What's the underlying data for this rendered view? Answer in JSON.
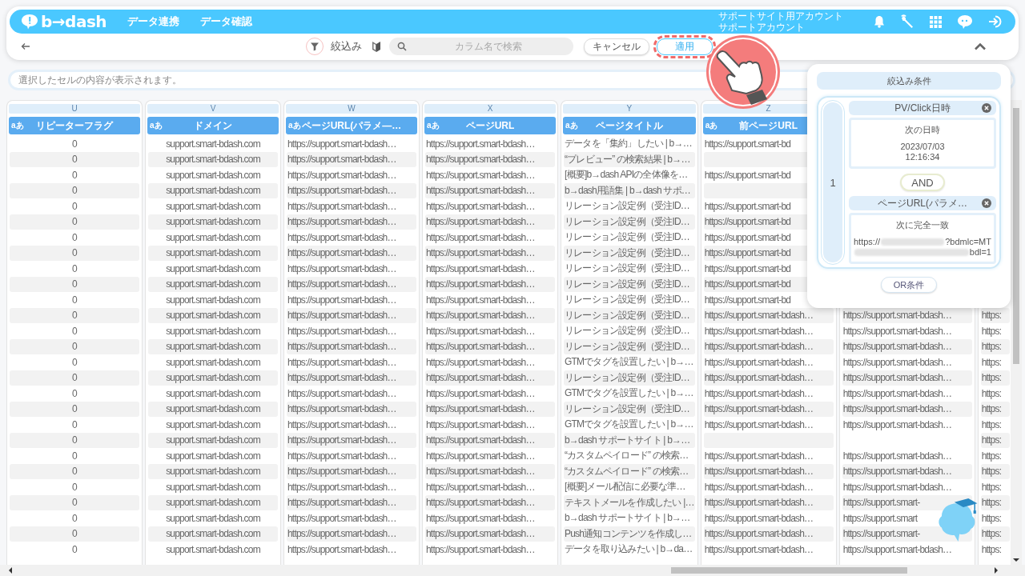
{
  "header": {
    "logo": "b→dash",
    "nav": [
      {
        "label": "データ連携"
      },
      {
        "label": "データ確認"
      }
    ],
    "account": {
      "site": "サポートサイト用アカウント",
      "name": "サポートアカウント"
    }
  },
  "toolbar": {
    "filter_label": "絞込み",
    "search": {
      "placeholder": "カラム名で検索"
    },
    "buttons": [
      {
        "label": "キャンセル",
        "kind": "secondary",
        "highlighted": false
      },
      {
        "label": "適用",
        "kind": "primary",
        "highlighted": true
      }
    ]
  },
  "cell_viewer": {
    "placeholder": "選択したセルの内容が表示されます。"
  },
  "table": {
    "columns": [
      {
        "letter": "U",
        "type_label": "aあ",
        "label": "リピーターフラグ",
        "cells": [
          "0",
          "0",
          "0",
          "0",
          "0",
          "0",
          "0",
          "0",
          "0",
          "0",
          "0",
          "0",
          "0",
          "0",
          "0",
          "0",
          "0",
          "0",
          "0",
          "0",
          "0",
          "0",
          "0",
          "0",
          "0",
          "0",
          "0"
        ]
      },
      {
        "letter": "V",
        "type_label": "aあ",
        "label": "ドメイン",
        "cells": [
          "support.smart-bdash.com",
          "support.smart-bdash.com",
          "support.smart-bdash.com",
          "support.smart-bdash.com",
          "support.smart-bdash.com",
          "support.smart-bdash.com",
          "support.smart-bdash.com",
          "support.smart-bdash.com",
          "support.smart-bdash.com",
          "support.smart-bdash.com",
          "support.smart-bdash.com",
          "support.smart-bdash.com",
          "support.smart-bdash.com",
          "support.smart-bdash.com",
          "support.smart-bdash.com",
          "support.smart-bdash.com",
          "support.smart-bdash.com",
          "support.smart-bdash.com",
          "support.smart-bdash.com",
          "support.smart-bdash.com",
          "support.smart-bdash.com",
          "support.smart-bdash.com",
          "support.smart-bdash.com",
          "support.smart-bdash.com",
          "support.smart-bdash.com",
          "support.smart-bdash.com",
          "support.smart-bdash.com"
        ]
      },
      {
        "letter": "W",
        "type_label": "aあ",
        "label": "ページURL(パラメ―…",
        "cells": [
          "https://support.smart-bdash…",
          "https://support.smart-bdash…",
          "https://support.smart-bdash…",
          "https://support.smart-bdash…",
          "https://support.smart-bdash…",
          "https://support.smart-bdash…",
          "https://support.smart-bdash…",
          "https://support.smart-bdash…",
          "https://support.smart-bdash…",
          "https://support.smart-bdash…",
          "https://support.smart-bdash…",
          "https://support.smart-bdash…",
          "https://support.smart-bdash…",
          "https://support.smart-bdash…",
          "https://support.smart-bdash…",
          "https://support.smart-bdash…",
          "https://support.smart-bdash…",
          "https://support.smart-bdash…",
          "https://support.smart-bdash…",
          "https://support.smart-bdash…",
          "https://support.smart-bdash…",
          "https://support.smart-bdash…",
          "https://support.smart-bdash…",
          "https://support.smart-bdash…",
          "https://support.smart-bdash…",
          "https://support.smart-bdash…",
          "https://support.smart-bdash…"
        ]
      },
      {
        "letter": "X",
        "type_label": "aあ",
        "label": "ページURL",
        "cells": [
          "https://support.smart-bdash…",
          "https://support.smart-bdash…",
          "https://support.smart-bdash…",
          "https://support.smart-bdash…",
          "https://support.smart-bdash…",
          "https://support.smart-bdash…",
          "https://support.smart-bdash…",
          "https://support.smart-bdash…",
          "https://support.smart-bdash…",
          "https://support.smart-bdash…",
          "https://support.smart-bdash…",
          "https://support.smart-bdash…",
          "https://support.smart-bdash…",
          "https://support.smart-bdash…",
          "https://support.smart-bdash…",
          "https://support.smart-bdash…",
          "https://support.smart-bdash…",
          "https://support.smart-bdash…",
          "https://support.smart-bdash…",
          "https://support.smart-bdash…",
          "https://support.smart-bdash…",
          "https://support.smart-bdash…",
          "https://support.smart-bdash…",
          "https://support.smart-bdash…",
          "https://support.smart-bdash…",
          "https://support.smart-bdash…",
          "https://support.smart-bdash…"
        ]
      },
      {
        "letter": "Y",
        "type_label": "aあ",
        "label": "ページタイトル",
        "cells": [
          "データを「集約」したい | b→…",
          "“プレビュー” の検索結果 | b→…",
          "[概要]b→dash APIの全体像を…",
          "b→dash用語集 | b→dash サポ…",
          "リレーション設定例（受注ID…",
          "リレーション設定例（受注ID…",
          "リレーション設定例（受注ID…",
          "リレーション設定例（受注ID…",
          "リレーション設定例（受注ID…",
          "リレーション設定例（受注ID…",
          "リレーション設定例（受注ID…",
          "リレーション設定例（受注ID…",
          "リレーション設定例（受注ID…",
          "リレーション設定例（受注ID…",
          "GTMでタグを設置したい | b→…",
          "リレーション設定例（受注ID…",
          "GTMでタグを設置したい | b→…",
          "リレーション設定例（受注ID…",
          "GTMでタグを設置したい | b→…",
          "b→dash サポートサイト | b→…",
          "“カスタムペイロード” の検索…",
          "“カスタムペイロード” の検索…",
          "[概要]メール配信に必要な準…",
          "テキストメールを作成したい |…",
          "b→dash サポートサイト | b→…",
          "Push通知コンテンツを作成し…",
          "データを取り込みたい | b→da…"
        ]
      },
      {
        "letter": "Z",
        "type_label": "aあ",
        "label": "前ページURL",
        "cells": [
          "https://support.smart-bd",
          null,
          "https://support.smart-bd",
          null,
          "https://support.smart-bd",
          "https://support.smart-bd",
          "https://support.smart-bd",
          "https://support.smart-bd",
          "https://support.smart-bd",
          "https://support.smart-bd",
          "https://support.smart-bd",
          "https://support.smart-bdash…",
          "https://support.smart-bdash…",
          "https://support.smart-bdash…",
          "https://support.smart-bdash…",
          "https://support.smart-bdash…",
          "https://support.smart-bdash…",
          "https://support.smart-bdash…",
          "https://support.smart-bdash…",
          null,
          "https://support.smart-bdash…",
          "https://support.smart-bdash…",
          "https://support.smart-bdash…",
          "https://support.smart-bdash…",
          "https://support.smart-bdash…",
          "https://support.smart-bdash…",
          "https://support.smart-bdash…"
        ]
      },
      {
        "cells": [
          null,
          null,
          null,
          null,
          null,
          null,
          null,
          null,
          null,
          null,
          null,
          "https://support.smart-bdash…",
          "https://support.smart-bdash…",
          "https://support.smart-bdash…",
          "https://support.smart-bdash…",
          "https://support.smart-bdash…",
          "https://support.smart-bdash…",
          "https://support.smart-bdash…",
          "https://support.smart-bdash…",
          null,
          "https://support.smart-bdash…",
          "https://support.smart-bdash…",
          "https://support.smart-bdash…",
          "https://support.smart-",
          "https://support.smart",
          "https://support.smart-",
          "https://support.smart-bdash…"
        ]
      },
      {
        "cells": [
          null,
          null,
          null,
          null,
          null,
          null,
          null,
          null,
          null,
          null,
          null,
          "https:",
          "https:",
          "https:",
          "https:",
          "https:",
          "https:",
          "https:",
          "https:",
          "https:",
          "https:",
          "https:",
          "https:",
          "https:",
          "https:",
          "https:",
          "https:"
        ]
      }
    ]
  },
  "filter_panel": {
    "title": "絞込み条件",
    "groups": [
      {
        "number": "1",
        "joiner": "AND",
        "conditions": [
          {
            "field": "PV/Click日時",
            "operator": "次の日時",
            "value_lines": [
              [
                {
                  "kind": "text",
                  "text": "2023/07/03"
                }
              ],
              [
                {
                  "kind": "text",
                  "text": "12:16:34"
                }
              ]
            ]
          },
          {
            "field": "ページURL(パラメ…",
            "operator": "次に完全一致",
            "value_lines": [
              [
                {
                  "kind": "text",
                  "text": "https://"
                },
                {
                  "kind": "redacted"
                },
                {
                  "kind": "text",
                  "text": "?bdmlc=MT"
                }
              ],
              [
                {
                  "kind": "redacted"
                },
                {
                  "kind": "text",
                  "text": "bdl=1"
                }
              ]
            ]
          }
        ]
      }
    ],
    "or_button": "OR条件"
  }
}
